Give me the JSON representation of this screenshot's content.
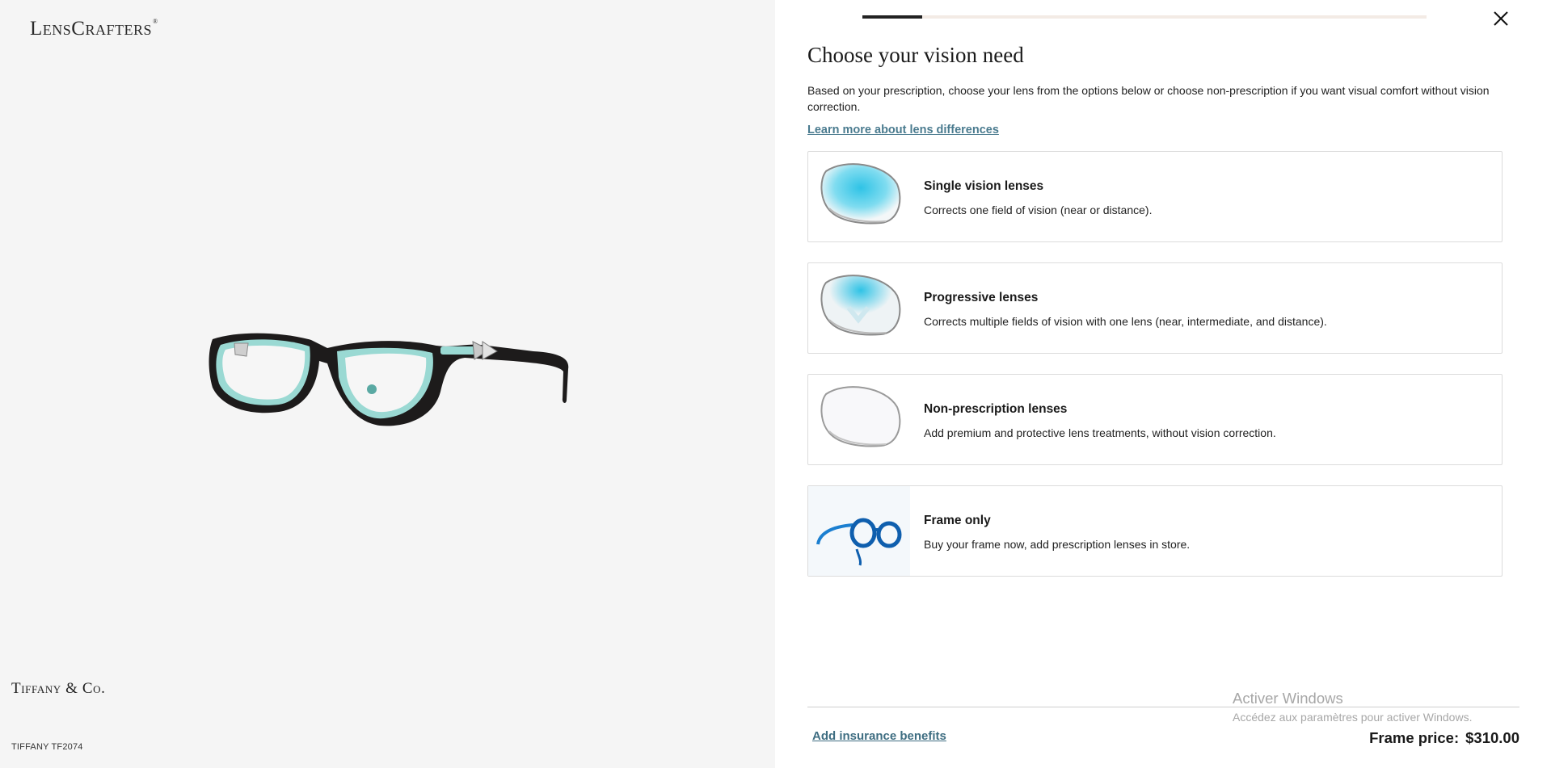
{
  "left": {
    "logo": "LensCrafters",
    "logo_mark": "®",
    "brand": "Tiffany & Co.",
    "model": "TIFFANY TF2074"
  },
  "progress": {
    "step_fraction": 0.106
  },
  "header": {
    "close_icon": "close-icon"
  },
  "main": {
    "title": "Choose your vision need",
    "intro": "Based on your prescription, choose your lens from the options below or choose non-prescription if you want visual comfort without vision correction.",
    "learn_link": "Learn more about lens differences",
    "options": [
      {
        "title": "Single vision lenses",
        "desc": "Corrects one field of vision (near or distance).",
        "icon": "single-vision-lens-icon"
      },
      {
        "title": "Progressive lenses",
        "desc": "Corrects multiple fields of vision with one lens (near, intermediate, and distance).",
        "icon": "progressive-lens-icon"
      },
      {
        "title": "Non-prescription lenses",
        "desc": "Add premium and protective lens treatments, without vision correction.",
        "icon": "non-prescription-lens-icon"
      },
      {
        "title": "Frame only",
        "desc": "Buy your frame now, add prescription lenses in store.",
        "icon": "frame-only-icon"
      }
    ]
  },
  "footer": {
    "insurance_link": "Add insurance benefits",
    "price_label": "Frame price:",
    "price_value": "$310.00"
  },
  "watermark": {
    "title": "Activer Windows",
    "subtitle": "Accédez aux paramètres pour activer Windows."
  },
  "colors": {
    "accent_link": "#4a7b8f",
    "lens_cyan": "#2fc3e6",
    "frame_accent": "#8fd8d2"
  }
}
